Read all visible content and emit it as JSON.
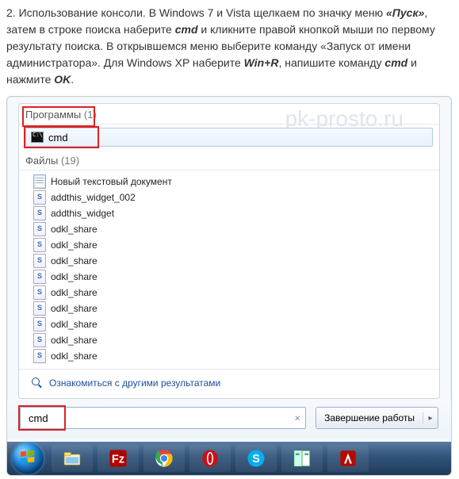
{
  "article": {
    "text_parts": [
      "2. Использование консоли. В Windows 7 и Vista щелкаем по значку меню ",
      "«Пуск»",
      ", затем в строке поиска наберите ",
      "cmd",
      " и кликните правой кнопкой мыши по первому результату поиска. В открывшемся меню выберите команду «Запуск от имени администратора». Для Windows XP наберите ",
      "Win+R",
      ", напишите команду ",
      "cmd",
      " и нажмите ",
      "OK",
      "."
    ]
  },
  "watermark": "pk-prosto.ru",
  "sections": {
    "programs_label": "Программы",
    "programs_count": "(1)",
    "program_item": "cmd",
    "files_label": "Файлы",
    "files_count": "(19)",
    "files": [
      {
        "icon": "doc",
        "name": "Новый текстовый документ"
      },
      {
        "icon": "js",
        "name": "addthis_widget_002"
      },
      {
        "icon": "js",
        "name": "addthis_widget"
      },
      {
        "icon": "js",
        "name": "odkl_share"
      },
      {
        "icon": "js",
        "name": "odkl_share"
      },
      {
        "icon": "js",
        "name": "odkl_share"
      },
      {
        "icon": "js",
        "name": "odkl_share"
      },
      {
        "icon": "js",
        "name": "odkl_share"
      },
      {
        "icon": "js",
        "name": "odkl_share"
      },
      {
        "icon": "js",
        "name": "odkl_share"
      },
      {
        "icon": "js",
        "name": "odkl_share"
      },
      {
        "icon": "js",
        "name": "odkl_share"
      }
    ],
    "see_more": "Ознакомиться с другими результатами"
  },
  "search": {
    "value": "cmd",
    "clear": "×"
  },
  "shutdown": {
    "label": "Завершение работы",
    "arrow": "▸"
  },
  "taskbar_items": [
    "explorer",
    "filezilla",
    "chrome",
    "opera",
    "skype",
    "totalcmd",
    "adobe"
  ]
}
